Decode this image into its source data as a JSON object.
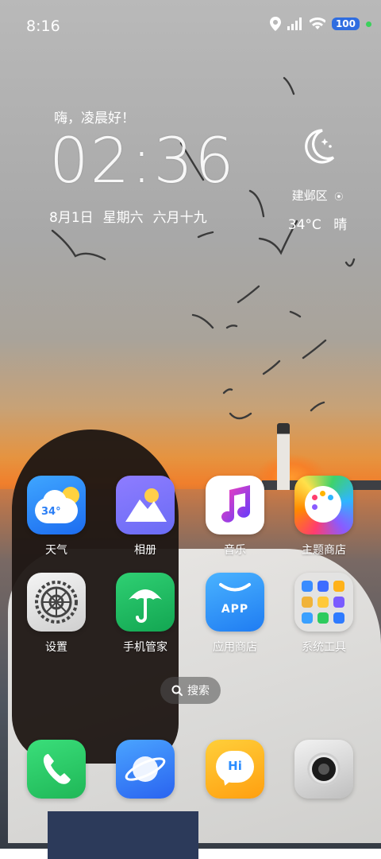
{
  "status_bar": {
    "time": "8:16",
    "battery": "100"
  },
  "widget": {
    "greeting": "嗨，凌晨好！",
    "clock": "02:36",
    "date": "8月1日",
    "weekday": "星期六",
    "lunar": "六月十九",
    "location": "建邺区",
    "temperature": "34°C",
    "condition": "晴"
  },
  "apps": [
    {
      "label": "天气",
      "icon": "weather-icon"
    },
    {
      "label": "相册",
      "icon": "gallery-icon"
    },
    {
      "label": "音乐",
      "icon": "music-icon"
    },
    {
      "label": "主题商店",
      "icon": "theme-store-icon"
    },
    {
      "label": "设置",
      "icon": "settings-icon"
    },
    {
      "label": "手机管家",
      "icon": "phone-manager-icon"
    },
    {
      "label": "应用商店",
      "icon": "app-store-icon"
    },
    {
      "label": "系统工具",
      "icon": "system-tools-folder-icon"
    }
  ],
  "weather_icon_temp": "34°",
  "app_store_text": "APP",
  "search": {
    "label": "搜索"
  },
  "dock": [
    {
      "icon": "phone-icon"
    },
    {
      "icon": "browser-icon"
    },
    {
      "icon": "messages-icon",
      "text": "Hi"
    },
    {
      "icon": "camera-icon"
    }
  ],
  "colors": {
    "battery": "#2f6de0",
    "status_dot": "#3ad15b"
  }
}
